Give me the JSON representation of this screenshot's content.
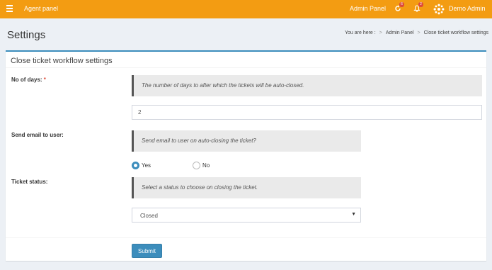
{
  "topbar": {
    "app_title": "Agent panel",
    "admin_panel": "Admin Panel",
    "sync_badge": "6",
    "notifications_badge": "2",
    "user_name": "Demo Admin",
    "bg_color": "#f39c12"
  },
  "header": {
    "title": "Settings",
    "breadcrumb": {
      "prefix": "You are here :",
      "separator": ">",
      "items": [
        "Admin Panel",
        "Close ticket workflow settings"
      ]
    }
  },
  "box": {
    "title": "Close ticket workflow settings",
    "accent_color": "#3c8dbc"
  },
  "form": {
    "days": {
      "label": "No of days:",
      "required_marker": "*",
      "help": "The number of days to after which the tickets will be auto-closed.",
      "value": "2"
    },
    "send_email": {
      "label": "Send email to user:",
      "help": "Send email to user on auto-closing the ticket?",
      "options": [
        "Yes",
        "No"
      ],
      "selected": "Yes"
    },
    "ticket_status": {
      "label": "Ticket status:",
      "help": "Select a status to choose on closing the ticket.",
      "selected": "Closed"
    },
    "submit_label": "Submit"
  }
}
